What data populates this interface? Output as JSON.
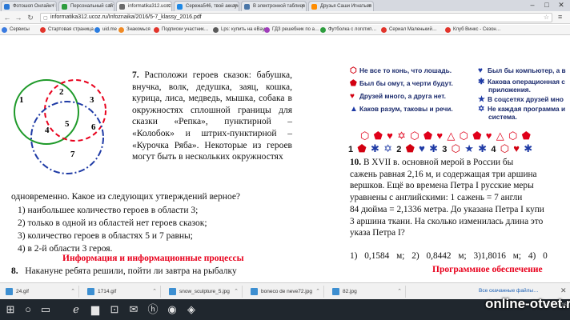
{
  "browser": {
    "tabs": [
      {
        "label": "Фотошоп Онлайн / Photo",
        "active": false,
        "icon_color": "#2b78d6"
      },
      {
        "label": "Персональный сайт - Ин",
        "active": false,
        "icon_color": "#2e9d3e"
      },
      {
        "label": "informatika312.ucoz.ru/In",
        "active": true,
        "icon_color": "#6b6b6b"
      },
      {
        "label": "Сережа546, твой аккаунт",
        "active": false,
        "icon_color": "#1e88e5"
      },
      {
        "label": "В электронной таблице",
        "active": false,
        "icon_color": "#4a76a8"
      },
      {
        "label": "Друзья Саши Игнатьев",
        "active": false,
        "icon_color": "#ff8c00"
      }
    ],
    "url": "informatika312.ucoz.ru/Infoznaika/2016/5-7_klassy_2016.pdf",
    "bookmarks": [
      {
        "label": "Сервисы",
        "color": "#3b7be0"
      },
      {
        "label": "Стартовая страница",
        "color": "#e2342b"
      },
      {
        "label": "uid.me",
        "color": "#2a7de1"
      },
      {
        "label": "Знакомься",
        "color": "#f08a24"
      },
      {
        "label": "Подписки участник…",
        "color": "#e2342b"
      },
      {
        "label": "Lps: купить на eBay…",
        "color": "#5a5a5a"
      },
      {
        "label": "ГДЗ решебник по а…",
        "color": "#a03dbb"
      },
      {
        "label": "Футболка с логотип…",
        "color": "#2e9d3e"
      },
      {
        "label": "Сериал Маленький…",
        "color": "#e2342b"
      },
      {
        "label": "Клуб Винкс - Сезон…",
        "color": "#e2342b"
      }
    ]
  },
  "pdf": {
    "venn_labels": [
      "1",
      "2",
      "3",
      "4",
      "5",
      "6",
      "7"
    ],
    "q7": {
      "num": "7.",
      "text": "Расположи героев сказок: бабушка, внучка, волк, дедушка, заяц, кошка, курица, лиса, медведь, мышка, собака в окружностях сплошной границы для сказки «Репка», пунктирной – «Колобок» и штрих-пунктирной – «Курочка Ряба». Некоторые из героев могут быть в нескольких окружностях",
      "text_full": "одновременно. Какое из следующих утверждений верное?",
      "options": [
        "1) наибольшее количество героев в области 3;",
        "2) только в одной из областей нет героев сказок;",
        "3) количество героев в областях 5 и 7 равны;",
        "4) в 2-й области 3 героя."
      ]
    },
    "section1": "Информация и информационные процессы",
    "q8": {
      "num": "8.",
      "text": "Накануне ребята решили, пойти ли завтра на рыбалку"
    },
    "legend": [
      {
        "symbol": "⬡",
        "blue": false,
        "text": "Не все то конь, что лошадь."
      },
      {
        "symbol": "⬟",
        "blue": false,
        "text": "Был бы омут, а черти будут."
      },
      {
        "symbol": "♥",
        "blue": false,
        "text": "Друзей много, а друга нет."
      },
      {
        "symbol": "▲",
        "blue": true,
        "text": "Каков разум, таковы и речи."
      },
      {
        "symbol": "♥",
        "blue": true,
        "text": "Был бы компьютер, а в"
      },
      {
        "symbol": "✱",
        "blue": true,
        "text": "Какова операционная с"
      },
      {
        "symbol": "",
        "blue": true,
        "text": "приложения."
      },
      {
        "symbol": "★",
        "blue": true,
        "text": "В соцсетях друзей мно"
      },
      {
        "symbol": "✡",
        "blue": true,
        "text": "Не каждая программа и"
      },
      {
        "symbol": "",
        "blue": true,
        "text": "система."
      }
    ],
    "symbol_row1": "⬡ ⬟ ♥ ✡ ⬡ ⬟ ♥ △ ⬡ ⬟ ♥ △ ⬡ ⬟",
    "symbol_row2": [
      {
        "t": "1",
        "c": "k"
      },
      {
        "t": " ⬟ ",
        "c": "r"
      },
      {
        "t": "✱ ✡ ",
        "c": "b"
      },
      {
        "t": "2",
        "c": "k"
      },
      {
        "t": " ⬟ ",
        "c": "r"
      },
      {
        "t": "♥ ✱ ",
        "c": "b"
      },
      {
        "t": "3",
        "c": "k"
      },
      {
        "t": " ⬡ ",
        "c": "r"
      },
      {
        "t": "★ ✱ ",
        "c": "b"
      },
      {
        "t": "4",
        "c": "k"
      },
      {
        "t": " ⬡ ♥ ",
        "c": "r"
      },
      {
        "t": "✱",
        "c": "b"
      }
    ],
    "q10": {
      "num": "10.",
      "lines": [
        "В XVII в. основной мерой в России бы",
        "сажень равная 2,16 м, и содержащая три аршина",
        "вершков. Ещё во времена Петра I русские меры",
        "уравнены с английскими: 1 сажень = 7 англи",
        "84 дюйма = 2,1336 метра. До указана Петра I купи",
        "3 аршина ткани. На сколько изменилась длина это",
        "указа Петра I?"
      ]
    },
    "q10_answers": "1)    0,1584 м;    2) 0,8442 м;    3)1,8016 м;    4) 0",
    "section2": "Программное обеспечение"
  },
  "downloads": [
    {
      "name": "24.gif"
    },
    {
      "name": "1714.gif"
    },
    {
      "name": "snow_sculpture_5.jpg"
    },
    {
      "name": "boneco de neve72.jpg"
    },
    {
      "name": "82.jpg"
    }
  ],
  "downloads_all": "Все скачанные файлы…",
  "taskbar": {
    "time": "21.02.2016"
  },
  "watermark": "online-otvet.ru"
}
